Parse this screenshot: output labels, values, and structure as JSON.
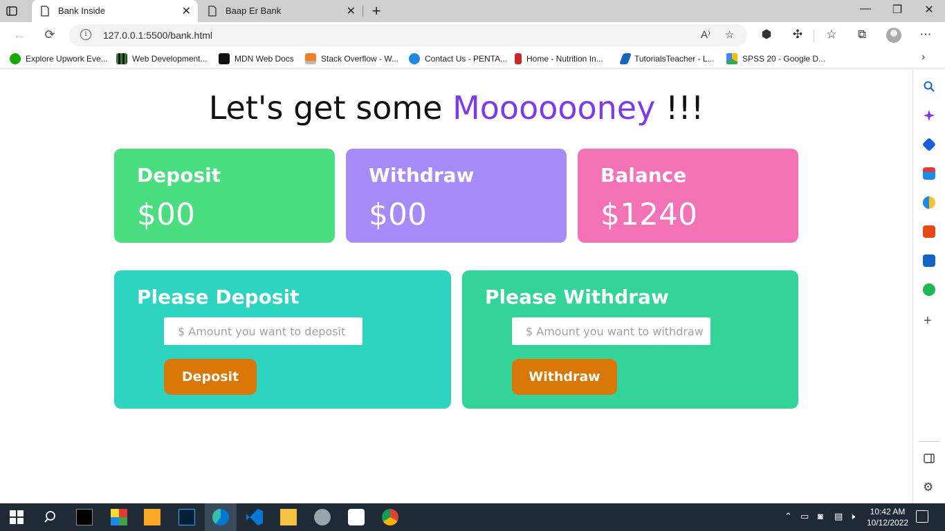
{
  "browser": {
    "tabs": [
      {
        "title": "Bank Inside",
        "active": true
      },
      {
        "title": "Baap Er Bank",
        "active": false
      }
    ],
    "address": {
      "url": "127.0.0.1:5500/bank.html"
    },
    "bookmarks": [
      {
        "label": "Explore Upwork Eve...",
        "icon": "upwork-icon",
        "color": "#14a800"
      },
      {
        "label": "Web Development...",
        "icon": "grid-icon",
        "color": "#2e7d32"
      },
      {
        "label": "MDN Web Docs",
        "icon": "mdn-icon",
        "color": "#111111"
      },
      {
        "label": "Stack Overflow - W...",
        "icon": "stackoverflow-icon",
        "color": "#f48024"
      },
      {
        "label": "Contact Us - PENTA...",
        "icon": "star-icon",
        "color": "#1e88e5"
      },
      {
        "label": "Home - Nutrition In...",
        "icon": "bottle-icon",
        "color": "#c62828"
      },
      {
        "label": "TutorialsTeacher - L...",
        "icon": "tutorialsteacher-icon",
        "color": "#1565c0"
      },
      {
        "label": "SPSS 20 - Google D...",
        "icon": "google-drive-icon",
        "color": "#fbbc04"
      }
    ]
  },
  "page": {
    "headline_prefix": "Let's get some ",
    "headline_accent": "Mooooooney",
    "headline_suffix": " !!!",
    "stats": {
      "deposit": {
        "label": "Deposit",
        "value": "$00"
      },
      "withdraw": {
        "label": "Withdraw",
        "value": "$00"
      },
      "balance": {
        "label": "Balance",
        "value": "$1240"
      }
    },
    "deposit_panel": {
      "title": "Please Deposit",
      "placeholder": "$ Amount you want to deposit",
      "button": "Deposit"
    },
    "withdraw_panel": {
      "title": "Please Withdraw",
      "placeholder": "$ Amount you want to withdraw",
      "button": "Withdraw"
    },
    "colors": {
      "accent": "#7c3aed",
      "deposit_card": "#4ade80",
      "withdraw_card": "#a78bfa",
      "balance_card": "#f472b6",
      "deposit_panel": "#2dd4bf",
      "withdraw_panel": "#34d399",
      "button": "#d97706"
    }
  },
  "taskbar": {
    "time": "10:42 AM",
    "date": "10/12/2022"
  }
}
